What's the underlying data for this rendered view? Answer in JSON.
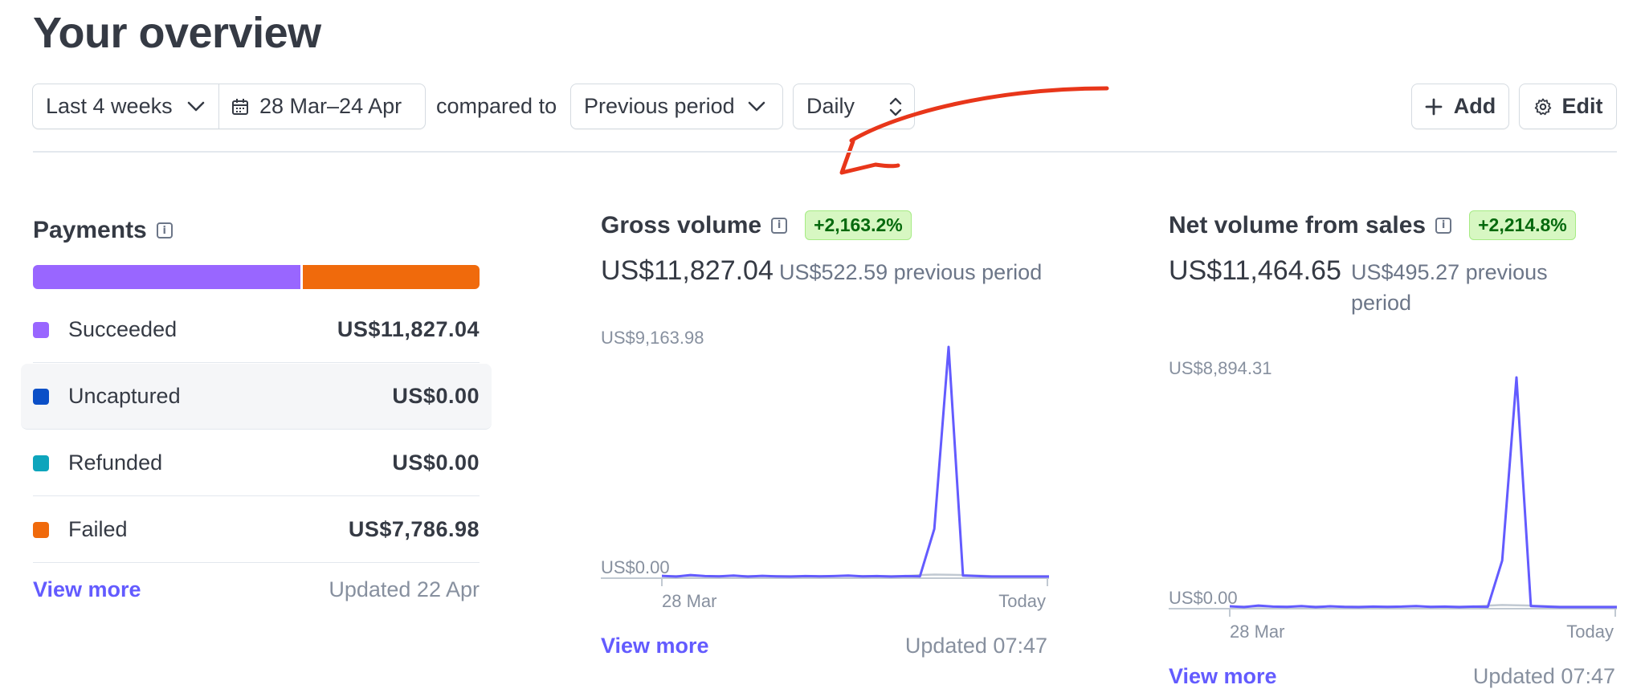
{
  "page": {
    "title": "Your overview"
  },
  "toolbar": {
    "range_label": "Last 4 weeks",
    "date_label": "28 Mar–24 Apr",
    "compared_label": "compared to",
    "period_label": "Previous period",
    "interval_label": "Daily",
    "add_label": "Add",
    "edit_label": "Edit"
  },
  "payments": {
    "title": "Payments",
    "bar": {
      "succeeded_fraction": 0.603,
      "failed_fraction": 0.397,
      "succeeded_color": "#9966ff",
      "failed_color": "#f06a0c"
    },
    "rows": [
      {
        "label": "Succeeded",
        "amount": "US$11,827.04",
        "color": "#9966ff"
      },
      {
        "label": "Uncaptured",
        "amount": "US$0.00",
        "color": "#0b4fc7"
      },
      {
        "label": "Refunded",
        "amount": "US$0.00",
        "color": "#0ea5bc"
      },
      {
        "label": "Failed",
        "amount": "US$7,786.98",
        "color": "#f06a0c"
      }
    ],
    "view_more": "View more",
    "updated": "Updated 22 Apr"
  },
  "gross": {
    "title": "Gross volume",
    "badge": "+2,163.2%",
    "value": "US$11,827.04",
    "previous": "US$522.59 previous period",
    "y_max_label": "US$9,163.98",
    "y_min_label": "US$0.00",
    "x_start": "28 Mar",
    "x_end": "Today",
    "view_more": "View more",
    "updated": "Updated 07:47"
  },
  "net": {
    "title": "Net volume from sales",
    "badge": "+2,214.8%",
    "value": "US$11,464.65",
    "previous": "US$495.27 previous period",
    "y_max_label": "US$8,894.31",
    "y_min_label": "US$0.00",
    "x_start": "28 Mar",
    "x_end": "Today",
    "view_more": "View more",
    "updated": "Updated 07:47"
  },
  "chart_data": [
    {
      "type": "line",
      "title": "Gross volume",
      "ylim": [
        0,
        9163.98
      ],
      "x_labels": [
        "28 Mar",
        "Today"
      ],
      "series": [
        {
          "values": [
            30,
            0,
            60,
            20,
            10,
            40,
            0,
            30,
            10,
            0,
            20,
            10,
            20,
            40,
            10,
            20,
            0,
            20,
            10,
            1900,
            9163.98,
            40,
            20,
            0,
            0,
            0,
            0,
            0
          ]
        },
        {
          "values": [
            20,
            20,
            20,
            20,
            20,
            20,
            20,
            20,
            20,
            20,
            20,
            20,
            20,
            20,
            20,
            20,
            20,
            20,
            60,
            80,
            70,
            60,
            40,
            20,
            20,
            20,
            20,
            20
          ]
        }
      ],
      "colors": [
        "#635bff",
        "#c1c9d2"
      ]
    },
    {
      "type": "line",
      "title": "Net volume from sales",
      "ylim": [
        0,
        8894.31
      ],
      "x_labels": [
        "28 Mar",
        "Today"
      ],
      "series": [
        {
          "values": [
            30,
            0,
            60,
            20,
            10,
            40,
            0,
            30,
            10,
            0,
            20,
            10,
            20,
            40,
            10,
            20,
            0,
            20,
            10,
            1800,
            8894.31,
            40,
            20,
            0,
            0,
            0,
            0,
            0
          ]
        },
        {
          "values": [
            20,
            20,
            20,
            20,
            20,
            20,
            20,
            20,
            20,
            20,
            20,
            20,
            20,
            20,
            20,
            20,
            20,
            20,
            60,
            80,
            70,
            60,
            40,
            20,
            20,
            20,
            20,
            20
          ]
        }
      ],
      "colors": [
        "#635bff",
        "#c1c9d2"
      ]
    }
  ]
}
